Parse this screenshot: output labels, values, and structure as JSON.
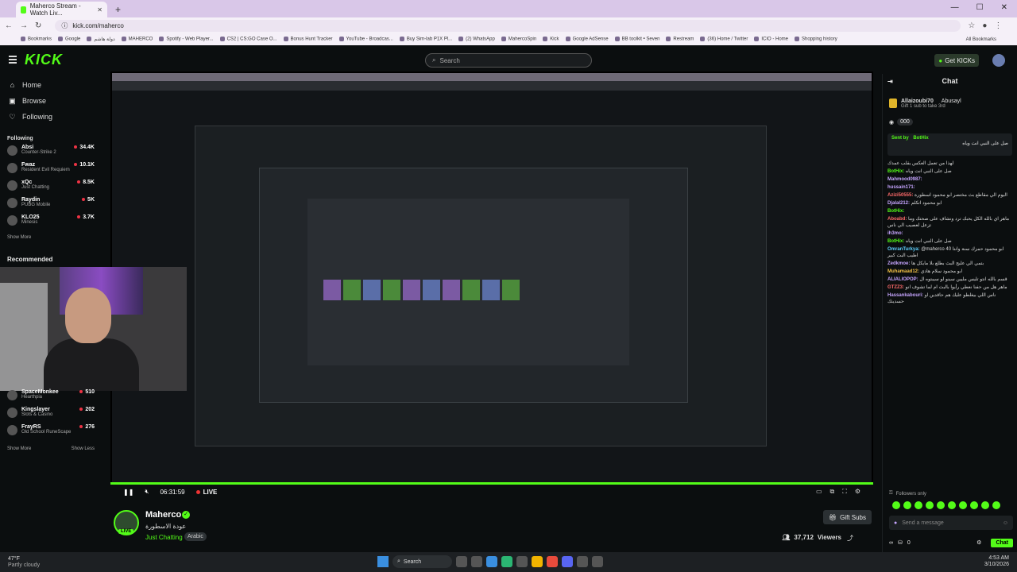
{
  "browser": {
    "tab_title": "Maherco Stream - Watch Liv...",
    "url": "kick.com/maherco",
    "bookmarks": [
      "Bookmarks",
      "Google",
      "دولة هاشم",
      "MAHERCO",
      "Spotify - Web Player...",
      "CS2 | CS:GO Case O...",
      "Bonus Hunt Tracker",
      "YouTube - Broadcas...",
      "Buy Sim-lab P1X Pl...",
      "(2) WhatsApp",
      "MahercoSpin",
      "Kick",
      "Google AdSense",
      "BB toolkit • Seven",
      "Restream",
      "(36) Home / Twitter",
      "ICIO - Home",
      "Shopping history"
    ],
    "all_bookmarks": "All Bookmarks"
  },
  "header": {
    "logo": "KICK",
    "search_placeholder": "Search",
    "get_kicks": "Get KICKs"
  },
  "nav": {
    "home": "Home",
    "browse": "Browse",
    "following": "Following"
  },
  "following": {
    "heading": "Following",
    "items": [
      {
        "name": "Absi",
        "game": "Counter-Strike 2",
        "viewers": "34.4K"
      },
      {
        "name": "Fwaz",
        "game": "Resident Evil Requiem",
        "viewers": "10.1K"
      },
      {
        "name": "xQc",
        "game": "Just Chatting",
        "viewers": "8.5K"
      },
      {
        "name": "Raydin",
        "game": "PUBG Mobile",
        "viewers": "5K"
      },
      {
        "name": "KLO25",
        "game": "Minesis",
        "viewers": "3.7K"
      }
    ],
    "show_more": "Show More"
  },
  "recommended": {
    "heading": "Recommended",
    "items": [
      {
        "name": "SpaceMonkee",
        "game": "Hearthpia",
        "viewers": "510"
      },
      {
        "name": "Kingslayer",
        "game": "Slots & Casino",
        "viewers": "202"
      },
      {
        "name": "FrayRS",
        "game": "Old School RuneScape",
        "viewers": "276"
      }
    ],
    "show_more": "Show More",
    "show_less": "Show Less"
  },
  "player": {
    "time": "06:31:59",
    "live": "LIVE"
  },
  "channel": {
    "name": "Maherco",
    "title": "عودة الاسطورة",
    "category": "Just Chatting",
    "language": "Arabic",
    "viewers": "37,712",
    "viewers_label": "Viewers",
    "gift_subs": "Gift Subs",
    "live_badge": "LIVE"
  },
  "chat": {
    "title": "Chat",
    "top_gifter": "Allaizoubi70",
    "top_gifter_2": "Abusayl",
    "gift_note": "Gift 1 sub to take 3rd",
    "goal_count": "000",
    "pinned_sender": "Sent by",
    "pinned_user": "BotHix",
    "pinned_text": "صل على النبي انت وياه",
    "messages": [
      {
        "user": "",
        "text": "لهذا من تعمل العكس يقلب عمدك",
        "cls": ""
      },
      {
        "user": "BotHix:",
        "text": "صل على النبي انت وياه",
        "cls": "u3"
      },
      {
        "user": "Mahmood0987:",
        "text": "",
        "cls": "u1"
      },
      {
        "user": "hussain171:",
        "text": "",
        "cls": "u1"
      },
      {
        "user": "Azizi50555:",
        "text": "اليوم الي مقاطع بث مختصر ابو محمود اسطورة",
        "cls": "u2"
      },
      {
        "user": "Djalal212:",
        "text": "ابو محمود اتكلم",
        "cls": "u1"
      },
      {
        "user": "BotHix:",
        "text": "",
        "cls": "u3"
      },
      {
        "user": "Aboabd:",
        "text": "ماهر اي بالله الكل يحبك ترد ونشاف على صحتك وما تزعل لعصيب الي ناس",
        "cls": "u2"
      },
      {
        "user": "ih3mo:",
        "text": "",
        "cls": "u1"
      },
      {
        "user": "BotHix:",
        "text": "صل على النبي انت وياه",
        "cls": "u3"
      },
      {
        "user": "OmranTurkya:",
        "text": "@maherco 40 ابو محمود حمزك سنة وانتا اطيب البث كبير",
        "cls": "u5"
      },
      {
        "user": "Zedkmoe:",
        "text": "بتمي الي عليج البث بطلع بلا مايكل ها",
        "cls": "u1"
      },
      {
        "user": "Muhamaad12:",
        "text": "ابو محمود سلام هادي",
        "cls": "u4"
      },
      {
        "user": "ALIALIOPOP:",
        "text": "قسم بالله انتو تليس مليين سينو لو سيبتوه ال",
        "cls": "u1"
      },
      {
        "user": "GTZZ3:",
        "text": "ماهر هل من حفنا نعطي رأيوا بالبث ام لما تشوف انو",
        "cls": "u2"
      },
      {
        "user": "Hassankabouri:",
        "text": "ناس اللي بيغلطو عليك هم حاقدين او حسدينك",
        "cls": "u1"
      }
    ],
    "followers_only": "Followers only",
    "send_placeholder": "Send a message",
    "count": "0",
    "chat_button": "Chat"
  },
  "taskbar": {
    "temp": "47°F",
    "weather": "Partly cloudy",
    "search": "Search",
    "time": "4:53 AM",
    "date": "3/10/2026"
  }
}
